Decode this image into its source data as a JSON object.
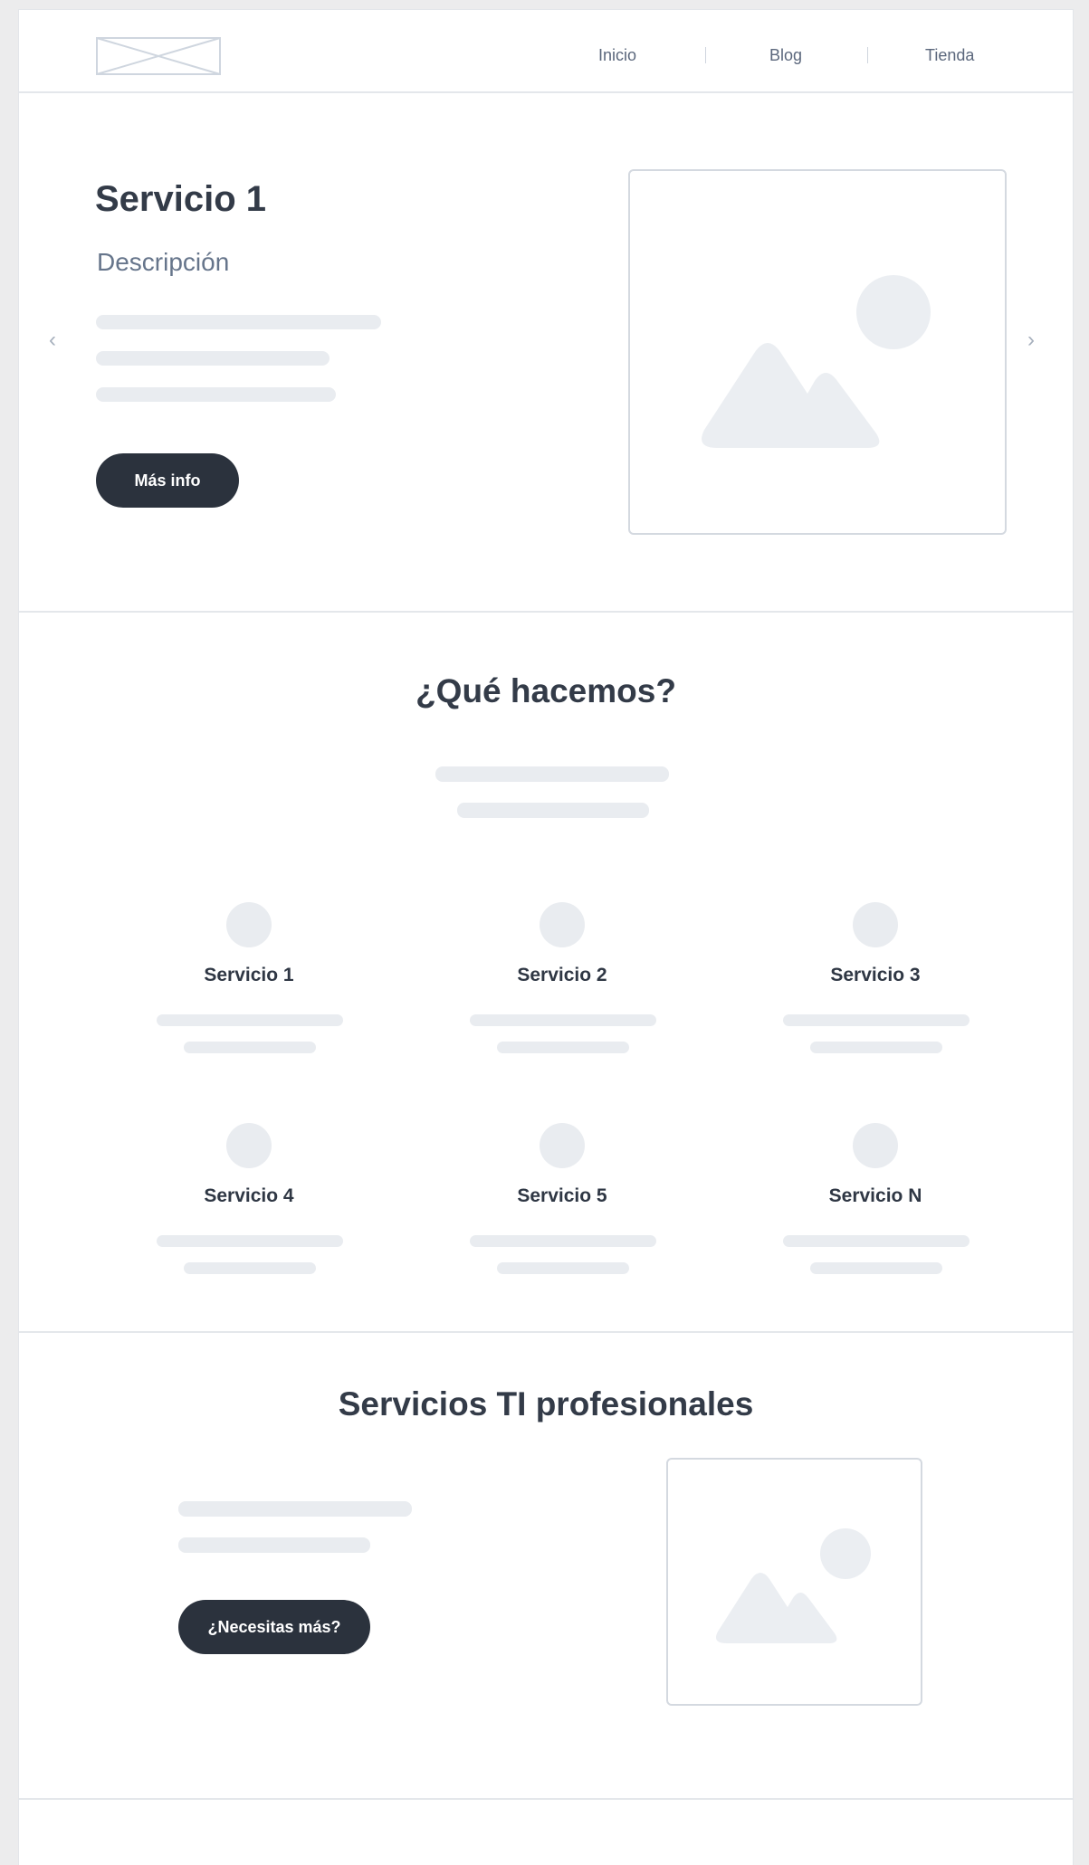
{
  "header": {
    "logo_icon": "logo-placeholder-icon",
    "nav": [
      {
        "label": "Inicio"
      },
      {
        "label": "Blog"
      },
      {
        "label": "Tienda"
      }
    ],
    "separator": "|"
  },
  "hero": {
    "title": "Servicio 1",
    "description": "Descripción",
    "button_label": "Más info",
    "prev_arrow": "‹",
    "next_arrow": "›",
    "image_icon": "image-placeholder-icon"
  },
  "what_we_do": {
    "title": "¿Qué hacemos?",
    "services": [
      {
        "label": "Servicio 1"
      },
      {
        "label": "Servicio 2"
      },
      {
        "label": "Servicio 3"
      },
      {
        "label": "Servicio 4"
      },
      {
        "label": "Servicio 5"
      },
      {
        "label": "Servicio N"
      }
    ]
  },
  "pro_services": {
    "title": "Servicios TI profesionales",
    "button_label": "¿Necesitas más?",
    "image_icon": "image-placeholder-icon"
  },
  "colors": {
    "background": "#ececed",
    "card": "#ffffff",
    "placeholder": "#e9ecf0",
    "button": "#2b323d",
    "text": "#333b48",
    "muted_text": "#66758b",
    "border": "#d4d9e0"
  }
}
